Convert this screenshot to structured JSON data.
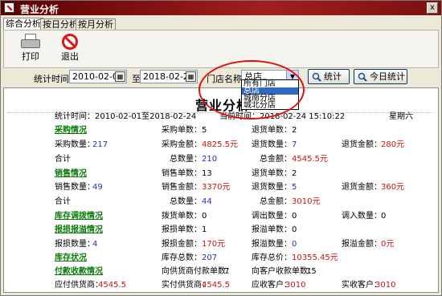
{
  "window": {
    "title": "营业分析",
    "close_glyph": "x"
  },
  "tabs": [
    {
      "label": "综合分析",
      "active": true
    },
    {
      "label": "按日分析",
      "active": false
    },
    {
      "label": "按月分析",
      "active": false
    }
  ],
  "toolbar": {
    "print_label": "打印",
    "exit_label": "退出"
  },
  "filter": {
    "time_label": "统计时间:",
    "start_date": "2010-02-01",
    "to_label": "至",
    "end_date": "2018-02-24",
    "store_label": "门店名称:",
    "store_value": "总店",
    "stats_button": "统计",
    "today_button": "今日统计",
    "store_options": [
      "所有门店",
      "总店",
      "城南分店",
      "城北分店"
    ],
    "selected_option_index": 1
  },
  "report": {
    "title": "营业分析",
    "period": "统计时间：2010-02-01至2018-02-24",
    "current_time": "当前时间：2018-02-24 15:10:22",
    "weekday": "星期六",
    "purchase": {
      "header": "采购情况",
      "count_label": "采购单数：",
      "count": "5",
      "return_count_label": "退货单数：",
      "return_count": "2",
      "qty_label": "采购数量：",
      "qty": "217",
      "amount_label": "采购金额：",
      "amount": "4825.5元",
      "return_qty_label": "退货数量：",
      "return_qty": "7",
      "return_amount_label": "退货金额：",
      "return_amount": "280元",
      "total_label": "合计",
      "total_qty_label": "总数量：",
      "total_qty": "210",
      "total_amount_label": "总金额：",
      "total_amount": "4545.5元"
    },
    "sales": {
      "header": "销售情况",
      "count_label": "销售单数：",
      "count": "13",
      "return_count_label": "退货单数：",
      "return_count": "2",
      "qty_label": "销售数量：",
      "qty": "49",
      "amount_label": "销售金额：",
      "amount": "3370元",
      "return_qty_label": "退货数量：",
      "return_qty": "5",
      "return_amount_label": "退货金额：",
      "return_amount": "360元",
      "total_label": "合计",
      "total_qty_label": "总数量：",
      "total_qty": "44",
      "total_amount_label": "总金额：",
      "total_amount": "3010元"
    },
    "transfer": {
      "header": "库存调拨情况",
      "transfer_count_label": "拨货单数：",
      "transfer_count": "0",
      "out_qty_label": "调出数量：",
      "out_qty": "0",
      "in_qty_label": "调入数量：",
      "in_qty": "0"
    },
    "loss": {
      "header": "报损报溢情况",
      "loss_count_label": "报损单数：",
      "loss_count": "1",
      "overflow_count_label": "报溢单数：",
      "overflow_count": "0",
      "loss_qty_label": "报损数量：",
      "loss_qty": "4",
      "loss_amount_label": "报损金额：",
      "loss_amount": "170元",
      "overflow_qty_label": "报溢数量：",
      "overflow_qty": "0",
      "overflow_amount_label": "报溢金额：",
      "overflow_amount": "0元"
    },
    "stock": {
      "header": "库存状况",
      "qty_label": "库存总数：",
      "qty": "207",
      "value_label": "库存总价：",
      "value": "10355.45元"
    },
    "payments": {
      "header": "付款收款情况",
      "supplier_payments_label": "向供货商付款单数：",
      "supplier_payments": "7",
      "customer_receipts_label": "向客户收款单数：",
      "customer_receipts": "15",
      "payable_label": "应付供货商：",
      "payable": "4545.5",
      "paid_label": "实付供货商：",
      "paid": "4545.5",
      "receivable_label": "应收客户：",
      "receivable": "3010",
      "received_label": "实收客户：",
      "received": "3010"
    }
  }
}
